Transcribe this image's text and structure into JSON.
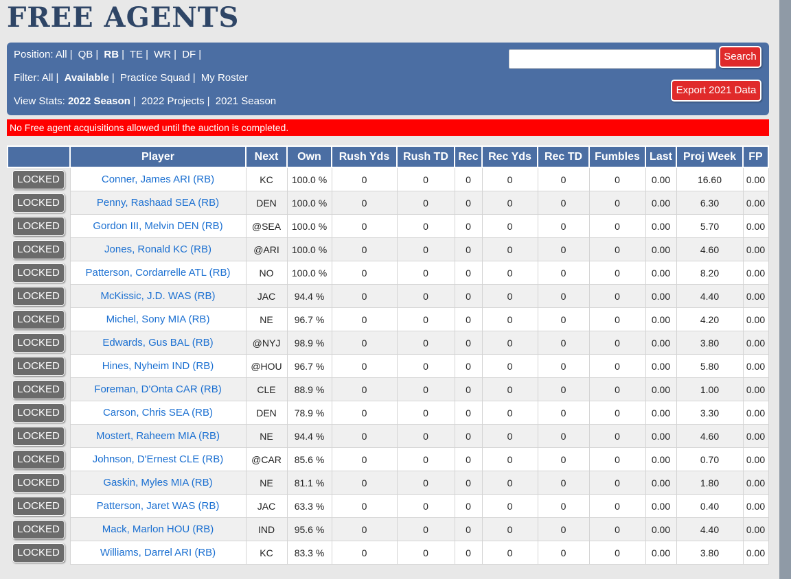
{
  "header": {
    "title": "FREE AGENTS"
  },
  "nav": {
    "position_label": "Position:",
    "positions": [
      {
        "label": "All",
        "active": false
      },
      {
        "label": "QB",
        "active": false
      },
      {
        "label": "RB",
        "active": true
      },
      {
        "label": "TE",
        "active": false
      },
      {
        "label": "WR",
        "active": false
      },
      {
        "label": "DF",
        "active": false
      }
    ],
    "filter_label": "Filter:",
    "filters": [
      {
        "label": "All",
        "active": false
      },
      {
        "label": "Available",
        "active": true
      },
      {
        "label": "Practice Squad",
        "active": false
      },
      {
        "label": "My Roster",
        "active": false
      }
    ],
    "stats_label": "View Stats:",
    "stats": [
      {
        "label": "2022 Season",
        "active": true
      },
      {
        "label": "2022 Projects",
        "active": false
      },
      {
        "label": "2021 Season",
        "active": false
      }
    ]
  },
  "search": {
    "placeholder": "",
    "value": "",
    "button_label": "Search"
  },
  "export": {
    "button_label": "Export 2021 Data"
  },
  "notice": "No Free agent acquisitions allowed until the auction is completed.",
  "table": {
    "columns": [
      "",
      "Player",
      "Next",
      "Own",
      "Rush Yds",
      "Rush TD",
      "Rec",
      "Rec Yds",
      "Rec TD",
      "Fumbles",
      "Last",
      "Proj Week",
      "FP"
    ],
    "lock_label": "LOCKED",
    "rows": [
      {
        "player": "Conner, James ARI (RB)",
        "next": "KC",
        "own": "100.0 %",
        "rush_yds": "0",
        "rush_td": "0",
        "rec": "0",
        "rec_yds": "0",
        "rec_td": "0",
        "fumbles": "0",
        "last": "0.00",
        "proj": "16.60",
        "fp": "0.00"
      },
      {
        "player": "Penny, Rashaad SEA (RB)",
        "next": "DEN",
        "own": "100.0 %",
        "rush_yds": "0",
        "rush_td": "0",
        "rec": "0",
        "rec_yds": "0",
        "rec_td": "0",
        "fumbles": "0",
        "last": "0.00",
        "proj": "6.30",
        "fp": "0.00"
      },
      {
        "player": "Gordon III, Melvin DEN (RB)",
        "next": "@SEA",
        "own": "100.0 %",
        "rush_yds": "0",
        "rush_td": "0",
        "rec": "0",
        "rec_yds": "0",
        "rec_td": "0",
        "fumbles": "0",
        "last": "0.00",
        "proj": "5.70",
        "fp": "0.00"
      },
      {
        "player": "Jones, Ronald KC (RB)",
        "next": "@ARI",
        "own": "100.0 %",
        "rush_yds": "0",
        "rush_td": "0",
        "rec": "0",
        "rec_yds": "0",
        "rec_td": "0",
        "fumbles": "0",
        "last": "0.00",
        "proj": "4.60",
        "fp": "0.00"
      },
      {
        "player": "Patterson, Cordarrelle ATL (RB)",
        "next": "NO",
        "own": "100.0 %",
        "rush_yds": "0",
        "rush_td": "0",
        "rec": "0",
        "rec_yds": "0",
        "rec_td": "0",
        "fumbles": "0",
        "last": "0.00",
        "proj": "8.20",
        "fp": "0.00"
      },
      {
        "player": "McKissic, J.D. WAS (RB)",
        "next": "JAC",
        "own": "94.4 %",
        "rush_yds": "0",
        "rush_td": "0",
        "rec": "0",
        "rec_yds": "0",
        "rec_td": "0",
        "fumbles": "0",
        "last": "0.00",
        "proj": "4.40",
        "fp": "0.00"
      },
      {
        "player": "Michel, Sony MIA (RB)",
        "next": "NE",
        "own": "96.7 %",
        "rush_yds": "0",
        "rush_td": "0",
        "rec": "0",
        "rec_yds": "0",
        "rec_td": "0",
        "fumbles": "0",
        "last": "0.00",
        "proj": "4.20",
        "fp": "0.00"
      },
      {
        "player": "Edwards, Gus BAL (RB)",
        "next": "@NYJ",
        "own": "98.9 %",
        "rush_yds": "0",
        "rush_td": "0",
        "rec": "0",
        "rec_yds": "0",
        "rec_td": "0",
        "fumbles": "0",
        "last": "0.00",
        "proj": "3.80",
        "fp": "0.00"
      },
      {
        "player": "Hines, Nyheim IND (RB)",
        "next": "@HOU",
        "own": "96.7 %",
        "rush_yds": "0",
        "rush_td": "0",
        "rec": "0",
        "rec_yds": "0",
        "rec_td": "0",
        "fumbles": "0",
        "last": "0.00",
        "proj": "5.80",
        "fp": "0.00"
      },
      {
        "player": "Foreman, D'Onta CAR (RB)",
        "next": "CLE",
        "own": "88.9 %",
        "rush_yds": "0",
        "rush_td": "0",
        "rec": "0",
        "rec_yds": "0",
        "rec_td": "0",
        "fumbles": "0",
        "last": "0.00",
        "proj": "1.00",
        "fp": "0.00"
      },
      {
        "player": "Carson, Chris SEA (RB)",
        "next": "DEN",
        "own": "78.9 %",
        "rush_yds": "0",
        "rush_td": "0",
        "rec": "0",
        "rec_yds": "0",
        "rec_td": "0",
        "fumbles": "0",
        "last": "0.00",
        "proj": "3.30",
        "fp": "0.00"
      },
      {
        "player": "Mostert, Raheem MIA (RB)",
        "next": "NE",
        "own": "94.4 %",
        "rush_yds": "0",
        "rush_td": "0",
        "rec": "0",
        "rec_yds": "0",
        "rec_td": "0",
        "fumbles": "0",
        "last": "0.00",
        "proj": "4.60",
        "fp": "0.00"
      },
      {
        "player": "Johnson, D'Ernest CLE (RB)",
        "next": "@CAR",
        "own": "85.6 %",
        "rush_yds": "0",
        "rush_td": "0",
        "rec": "0",
        "rec_yds": "0",
        "rec_td": "0",
        "fumbles": "0",
        "last": "0.00",
        "proj": "0.70",
        "fp": "0.00"
      },
      {
        "player": "Gaskin, Myles MIA (RB)",
        "next": "NE",
        "own": "81.1 %",
        "rush_yds": "0",
        "rush_td": "0",
        "rec": "0",
        "rec_yds": "0",
        "rec_td": "0",
        "fumbles": "0",
        "last": "0.00",
        "proj": "1.80",
        "fp": "0.00"
      },
      {
        "player": "Patterson, Jaret WAS (RB)",
        "next": "JAC",
        "own": "63.3 %",
        "rush_yds": "0",
        "rush_td": "0",
        "rec": "0",
        "rec_yds": "0",
        "rec_td": "0",
        "fumbles": "0",
        "last": "0.00",
        "proj": "0.40",
        "fp": "0.00"
      },
      {
        "player": "Mack, Marlon HOU (RB)",
        "next": "IND",
        "own": "95.6 %",
        "rush_yds": "0",
        "rush_td": "0",
        "rec": "0",
        "rec_yds": "0",
        "rec_td": "0",
        "fumbles": "0",
        "last": "0.00",
        "proj": "4.40",
        "fp": "0.00"
      },
      {
        "player": "Williams, Darrel ARI (RB)",
        "next": "KC",
        "own": "83.3 %",
        "rush_yds": "0",
        "rush_td": "0",
        "rec": "0",
        "rec_yds": "0",
        "rec_td": "0",
        "fumbles": "0",
        "last": "0.00",
        "proj": "3.80",
        "fp": "0.00"
      }
    ]
  }
}
